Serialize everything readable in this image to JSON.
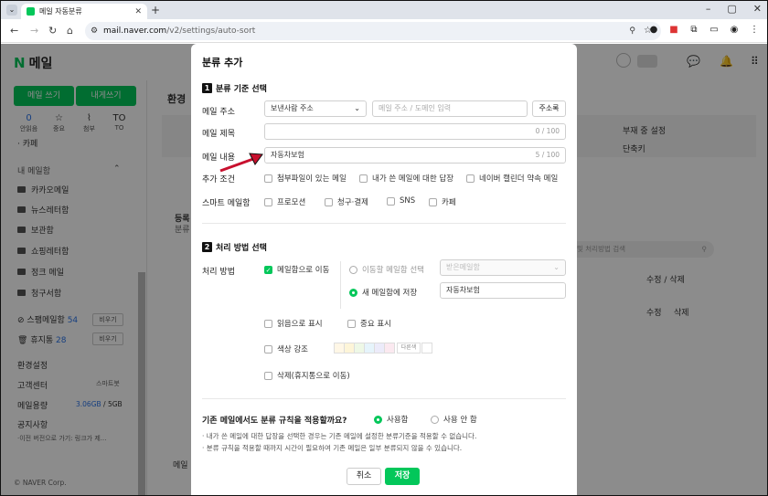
{
  "browser": {
    "tab_title": "메일 자동분류",
    "url_host": "mail.naver.com",
    "url_path": "/v2/settings/auto-sort"
  },
  "app": {
    "logo_text": "메일",
    "write_button": "메일 쓰기",
    "self_write_button": "내게쓰기",
    "quick": [
      {
        "glyph": "0",
        "label": "안읽음"
      },
      {
        "glyph": "☆",
        "label": "중요"
      },
      {
        "glyph": "⌇",
        "label": "첨부"
      },
      {
        "glyph": "TO",
        "label": "TO"
      }
    ],
    "cafe_label": "카페",
    "my_mailbox": "내 메일함",
    "folders": [
      "카카오메일",
      "뉴스레터함",
      "보관함",
      "쇼핑레터함",
      "정크 메일",
      "청구서함"
    ],
    "spam": {
      "label": "스팸메일함",
      "count": "54",
      "button": "비우기"
    },
    "trash": {
      "label": "휴지통",
      "count": "28",
      "button": "비우기"
    },
    "env": "환경설정",
    "support": "고객센터",
    "smartbot": "스마트봇",
    "storage_label": "메일용량",
    "storage_used": "3.06GB",
    "storage_total": " / 5GB",
    "notice": "공지사항",
    "notice_text": "·이전 버전으로 가기: 링크가 제...",
    "copyright": "© NAVER Corp."
  },
  "main": {
    "title": "환경",
    "absence": "부재 중 설정",
    "shortcut": "단축키",
    "reg_label": "등록",
    "sort_label": "분류",
    "search_placeholder": "및 처리방법 검색",
    "col_edit": "수정 / 삭제",
    "row_edit": "수정",
    "row_delete": "삭제",
    "bottom_label": "메일"
  },
  "modal": {
    "title": "분류 추가",
    "sec1_num": "1",
    "sec1_title": "분류 기준 선택",
    "mail_address_label": "메일 주소",
    "address_select": "보낸사람 주소",
    "address_placeholder": "메일 주소 / 도메인 입력",
    "address_book": "주소록",
    "subject_label": "메일 제목",
    "subject_count": "0 / 100",
    "content_label": "메일 내용",
    "content_value": "자동차보험",
    "content_count": "5 / 100",
    "extra_label": "추가 조건",
    "extra_options": [
      "첨부파일이 있는 메일",
      "내가 쓴 메일에 대한 답장",
      "네이버 캘린더 약속 메일"
    ],
    "smart_label": "스마트 메일함",
    "smart_options": [
      "프로모션",
      "청구·결제",
      "SNS",
      "카페"
    ],
    "sec2_num": "2",
    "sec2_title": "처리 방법 선택",
    "process_label": "처리 방법",
    "move_label": "메일함으로 이동",
    "move_existing": "이동할 메일함 선택",
    "existing_placeholder": "받은메일함",
    "save_new": "새 메일함에 저장",
    "new_box_value": "자동차보험",
    "mark_read": "읽음으로 표시",
    "mark_important": "중요 표시",
    "color_label": "색상 강조",
    "other_color": "다른색",
    "delete_label": "삭제(휴지통으로 이동)",
    "apply_question": "기존 메일에서도 분류 규칙을 적용할까요?",
    "apply_yes": "사용함",
    "apply_no": "사용 안 함",
    "note1": "· 내가 쓴 메일에 대한 답장을 선택한 경우는 기존 메일에 설정한 분류기준을 적용할 수 없습니다.",
    "note2": "· 분류 규칙을 적용할 때까지 시간이 필요하여 기존 메일은 일부 분류되지 않을 수 있습니다.",
    "cancel": "취소",
    "save": "저장"
  },
  "colors": {
    "brand": "#03c75a",
    "swatches": [
      "#fff7e6",
      "#fdf5d8",
      "#eef8e6",
      "#e6f4fb",
      "#ecebfa",
      "#fbe9f0"
    ]
  }
}
